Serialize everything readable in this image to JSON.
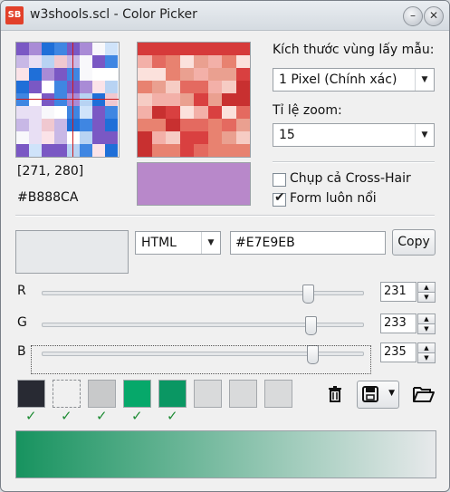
{
  "window": {
    "app_icon_text": "SB",
    "title": "w3shools.scl - Color Picker",
    "minimize_glyph": "–",
    "close_glyph": "✕"
  },
  "sampler": {
    "coordinates": "[271, 280]",
    "hex": "#B888CA",
    "preview_color": "#B888CA",
    "sample_size_label": "Kích thước vùng lấy mẫu:",
    "sample_size_value": "1 Pixel (Chính xác)",
    "zoom_label": "Tỉ lệ zoom:",
    "zoom_value": "15",
    "capture_crosshair_label": "Chụp cả Cross-Hair",
    "capture_crosshair_checked": false,
    "always_on_top_label": "Form luôn nổi",
    "always_on_top_checked": true
  },
  "color": {
    "current_swatch": "#E7E9EB",
    "format": "HTML",
    "value": "#E7E9EB",
    "copy_label": "Copy",
    "channels": [
      {
        "label": "R",
        "value": "231",
        "level": 231
      },
      {
        "label": "G",
        "value": "233",
        "level": 233
      },
      {
        "label": "B",
        "value": "235",
        "level": 235
      }
    ]
  },
  "palette": [
    {
      "color": "#282A33",
      "checked": true
    },
    {
      "color": "#F0F0F0",
      "checked": true
    },
    {
      "color": "#C8C9CA",
      "checked": true
    },
    {
      "color": "#06A86A",
      "checked": true
    },
    {
      "color": "#0A9763",
      "checked": true
    },
    {
      "color": "#D9DADB",
      "checked": false
    },
    {
      "color": "#D9DADB",
      "checked": false
    },
    {
      "color": "#D9DADB",
      "checked": false
    }
  ],
  "icons": {
    "trash": "trash-icon",
    "save": "save-icon",
    "open": "folder-open-icon"
  },
  "gradient": {
    "start_color": "#17935F",
    "end_color": "#E7E9EB"
  }
}
